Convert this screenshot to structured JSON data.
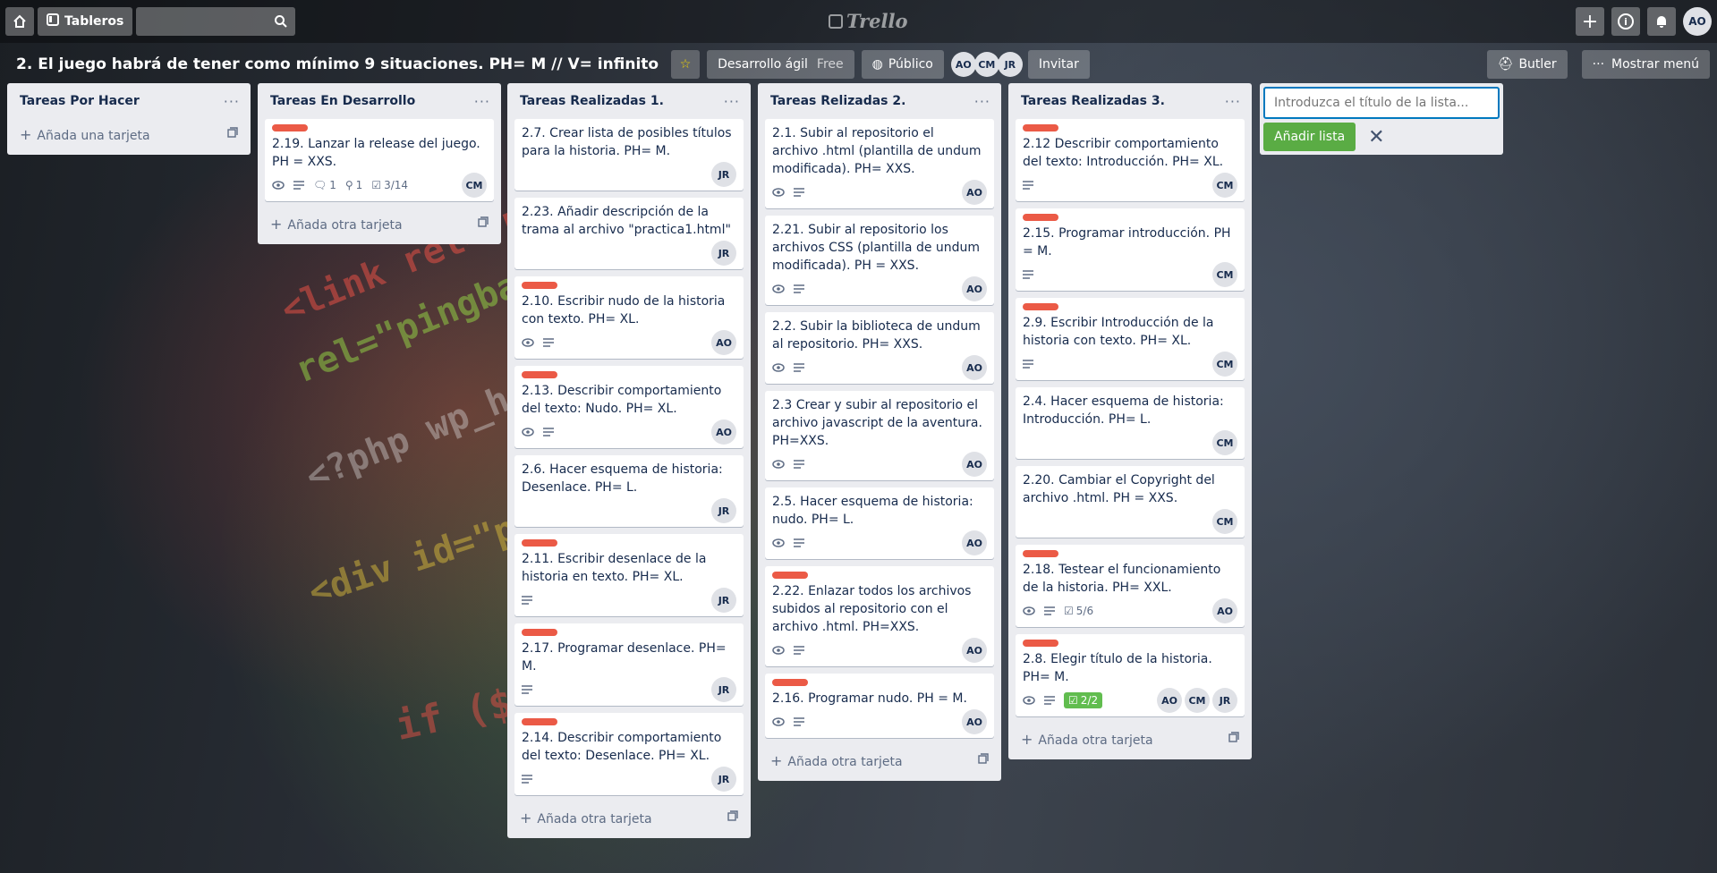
{
  "topbar": {
    "home_icon": "home-icon",
    "boards_label": "Tableros",
    "search_value": "",
    "logo": "Trello",
    "avatar": "AO"
  },
  "board": {
    "title": "2. El juego habrá de tener como mínimo 9 situaciones. PH= M // V= infinito",
    "team_label": "Desarrollo ágil",
    "team_plan": "Free",
    "visibility": "Público",
    "members": [
      "AO",
      "CM",
      "JR"
    ],
    "invite": "Invitar",
    "butler": "Butler",
    "menu": "Mostrar menú"
  },
  "colors": {
    "label_red": "#eb5a46",
    "check_done": "#61bd4f",
    "add_list": "#5aac44"
  },
  "lists": [
    {
      "title": "Tareas Por Hacer",
      "add": "Añada una tarjeta",
      "cards": []
    },
    {
      "title": "Tareas En Desarrollo",
      "add": "Añada otra tarjeta",
      "cards": [
        {
          "label": true,
          "text": "2.19. Lanzar la release del juego. PH = XXS.",
          "eye": true,
          "desc": true,
          "comments": "1",
          "attach": "1",
          "checklist": "3/14",
          "members": [
            "CM"
          ]
        }
      ]
    },
    {
      "title": "Tareas Realizadas 1.",
      "add": "Añada otra tarjeta",
      "cards": [
        {
          "text": "2.7. Crear lista de posibles títulos para la historia. PH= M.",
          "members": [
            "JR"
          ]
        },
        {
          "text": "2.23. Añadir descripción de la trama al archivo \"practica1.html\"",
          "members": [
            "JR"
          ]
        },
        {
          "label": true,
          "text": "2.10. Escribir nudo de la historia con texto. PH= XL.",
          "eye": true,
          "desc": true,
          "members": [
            "AO"
          ]
        },
        {
          "label": true,
          "text": "2.13. Describir comportamiento del texto: Nudo. PH= XL.",
          "eye": true,
          "desc": true,
          "members": [
            "AO"
          ]
        },
        {
          "text": "2.6. Hacer esquema de historia: Desenlace. PH= L.",
          "members": [
            "JR"
          ]
        },
        {
          "label": true,
          "text": "2.11. Escribir desenlace de la historia en texto. PH= XL.",
          "desc": true,
          "members": [
            "JR"
          ]
        },
        {
          "label": true,
          "text": "2.17. Programar desenlace. PH= M.",
          "desc": true,
          "members": [
            "JR"
          ]
        },
        {
          "label": true,
          "text": "2.14. Describir comportamiento del texto: Desenlace. PH= XL.",
          "desc": true,
          "members": [
            "JR"
          ]
        }
      ]
    },
    {
      "title": "Tareas Relizadas 2.",
      "add": "Añada otra tarjeta",
      "cards": [
        {
          "text": "2.1. Subir al repositorio el archivo .html (plantilla de undum modificada). PH= XXS.",
          "eye": true,
          "desc": true,
          "members": [
            "AO"
          ]
        },
        {
          "text": "2.21. Subir al repositorio los archivos CSS (plantilla de undum modificada). PH = XXS.",
          "eye": true,
          "desc": true,
          "members": [
            "AO"
          ]
        },
        {
          "text": "2.2. Subir la biblioteca de undum al repositorio. PH= XXS.",
          "eye": true,
          "desc": true,
          "members": [
            "AO"
          ]
        },
        {
          "text": "2.3 Crear y subir al repositorio el archivo javascript de la aventura. PH=XXS.",
          "eye": true,
          "desc": true,
          "members": [
            "AO"
          ]
        },
        {
          "text": "2.5. Hacer esquema de historia: nudo. PH= L.",
          "eye": true,
          "desc": true,
          "members": [
            "AO"
          ]
        },
        {
          "label": true,
          "text": "2.22. Enlazar todos los archivos subidos al repositorio con el archivo .html. PH=XXS.",
          "eye": true,
          "desc": true,
          "members": [
            "AO"
          ]
        },
        {
          "label": true,
          "text": "2.16. Programar nudo. PH = M.",
          "eye": true,
          "desc": true,
          "members": [
            "AO"
          ]
        }
      ]
    },
    {
      "title": "Tareas Realizadas 3.",
      "add": "Añada otra tarjeta",
      "cards": [
        {
          "label": true,
          "text": "2.12 Describir comportamiento del texto: Introducción. PH= XL.",
          "desc": true,
          "members": [
            "CM"
          ]
        },
        {
          "label": true,
          "text": "2.15. Programar introducción. PH = M.",
          "desc": true,
          "members": [
            "CM"
          ]
        },
        {
          "label": true,
          "text": "2.9. Escribir Introducción de la historia con texto. PH= XL.",
          "desc": true,
          "members": [
            "CM"
          ]
        },
        {
          "text": "2.4. Hacer esquema de historia: Introducción. PH= L.",
          "members": [
            "CM"
          ]
        },
        {
          "text": "2.20. Cambiar el Copyright del archivo .html. PH = XXS.",
          "members": [
            "CM"
          ]
        },
        {
          "label": true,
          "text": "2.18. Testear el funcionamiento de la historia. PH= XXL.",
          "eye": true,
          "desc": true,
          "checklist": "5/6",
          "members": [
            "AO"
          ]
        },
        {
          "label": true,
          "text": "2.8. Elegir título de la historia. PH= M.",
          "eye": true,
          "desc": true,
          "checklist_done": "2/2",
          "members": [
            "AO",
            "CM",
            "JR"
          ]
        }
      ]
    }
  ],
  "new_list": {
    "placeholder": "Introduzca el título de la lista...",
    "add_label": "Añadir lista"
  }
}
